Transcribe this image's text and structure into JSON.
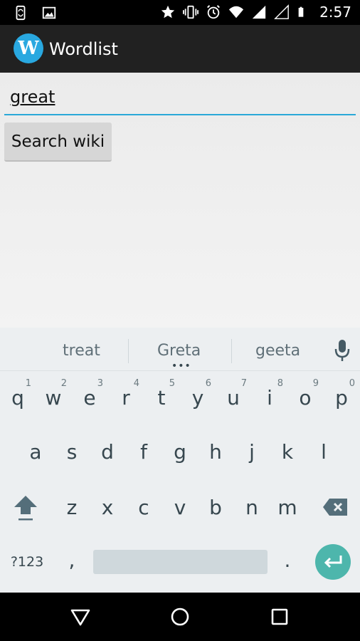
{
  "status_bar": {
    "time": "2:57",
    "icons_left": [
      "phone-sync-icon",
      "image-icon"
    ],
    "icons_right": [
      "star-icon",
      "vibrate-icon",
      "alarm-icon",
      "wifi-icon",
      "cell-signal-icon",
      "cell-signal-empty-icon",
      "battery-icon"
    ]
  },
  "app_bar": {
    "logo_letter": "W",
    "title": "Wordlist"
  },
  "search": {
    "value": "great",
    "button_label": "Search wiki",
    "accent_color": "#2aa8d8"
  },
  "keyboard": {
    "suggestions": [
      "treat",
      "Greta",
      "geeta"
    ],
    "row1": [
      {
        "key": "q",
        "hint": "1"
      },
      {
        "key": "w",
        "hint": "2"
      },
      {
        "key": "e",
        "hint": "3"
      },
      {
        "key": "r",
        "hint": "4"
      },
      {
        "key": "t",
        "hint": "5"
      },
      {
        "key": "y",
        "hint": "6"
      },
      {
        "key": "u",
        "hint": "7"
      },
      {
        "key": "i",
        "hint": "8"
      },
      {
        "key": "o",
        "hint": "9"
      },
      {
        "key": "p",
        "hint": "0"
      }
    ],
    "row2": [
      "a",
      "s",
      "d",
      "f",
      "g",
      "h",
      "j",
      "k",
      "l"
    ],
    "row3": [
      "z",
      "x",
      "c",
      "v",
      "b",
      "n",
      "m"
    ],
    "symbols_label": "?123",
    "comma": ",",
    "period": ".",
    "enter_color": "#4db6ac"
  },
  "nav_bar": {
    "buttons": [
      "back-icon",
      "home-icon",
      "recents-icon"
    ]
  }
}
